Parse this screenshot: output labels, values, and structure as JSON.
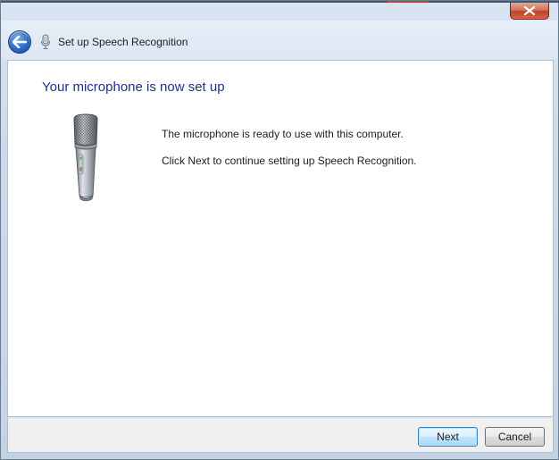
{
  "window": {
    "title": "Set up Speech Recognition"
  },
  "icons": {
    "close": "close-icon",
    "back": "back-arrow-icon",
    "title_icon": "microphone-icon",
    "illustration": "microphone-illustration"
  },
  "page": {
    "heading": "Your microphone is now set up",
    "message_ready": "The microphone is ready to use with this computer.",
    "message_next": "Click Next to continue setting up Speech Recognition."
  },
  "buttons": {
    "next_label": "Next",
    "cancel_label": "Cancel"
  },
  "colors": {
    "heading": "#1e3287",
    "close_button": "#c0412a",
    "back_button": "#2f6bc4",
    "default_button_border": "#3c7fb1"
  }
}
